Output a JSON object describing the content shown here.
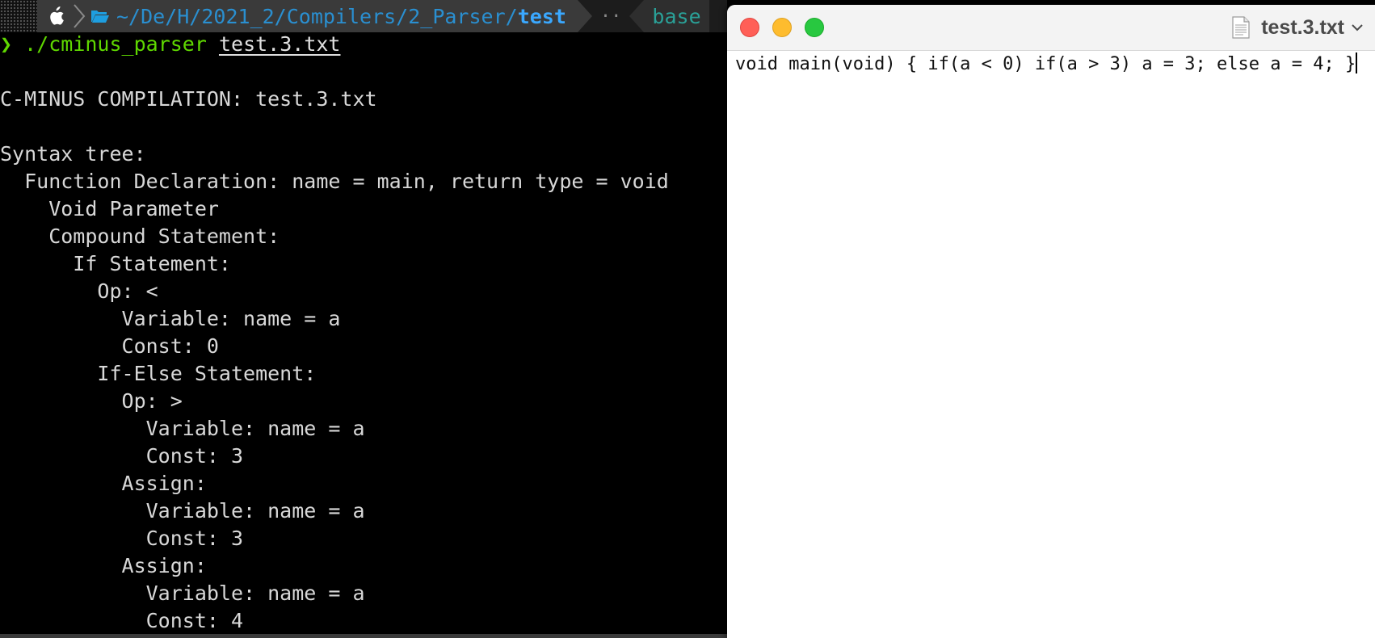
{
  "terminal": {
    "prompt": {
      "path_prefix": "~/De/H/2021_2/Compilers/2_Parser/",
      "path_current": "test",
      "dots": "··",
      "env_label": "base"
    },
    "command": {
      "caret": "❯",
      "program": "./cminus_parser",
      "argument": "test.3.txt"
    },
    "output_lines": [
      "C-MINUS COMPILATION: test.3.txt",
      "",
      "Syntax tree:",
      "  Function Declaration: name = main, return type = void",
      "    Void Parameter",
      "    Compound Statement:",
      "      If Statement:",
      "        Op: <",
      "          Variable: name = a",
      "          Const: 0",
      "        If-Else Statement:",
      "          Op: >",
      "            Variable: name = a",
      "            Const: 3",
      "          Assign:",
      "            Variable: name = a",
      "            Const: 3",
      "          Assign:",
      "            Variable: name = a",
      "            Const: 4"
    ]
  },
  "editor": {
    "document_title": "test.3.txt",
    "content": "void main(void) { if(a < 0) if(a > 3) a = 3; else a = 4; }"
  },
  "icons": {
    "os": "apple-icon",
    "folder": "folder-open-icon",
    "document": "document-icon",
    "title_menu": "chevron-down-icon"
  },
  "colors": {
    "terminal_bg": "#000000",
    "prompt_bg": "#3a3a3a",
    "path_blue": "#1e9ee0",
    "command_green": "#5fd700",
    "env_teal": "#2aa198",
    "traffic_close": "#ff5f57",
    "traffic_minimize": "#febc2e",
    "traffic_maximize": "#28c840"
  }
}
